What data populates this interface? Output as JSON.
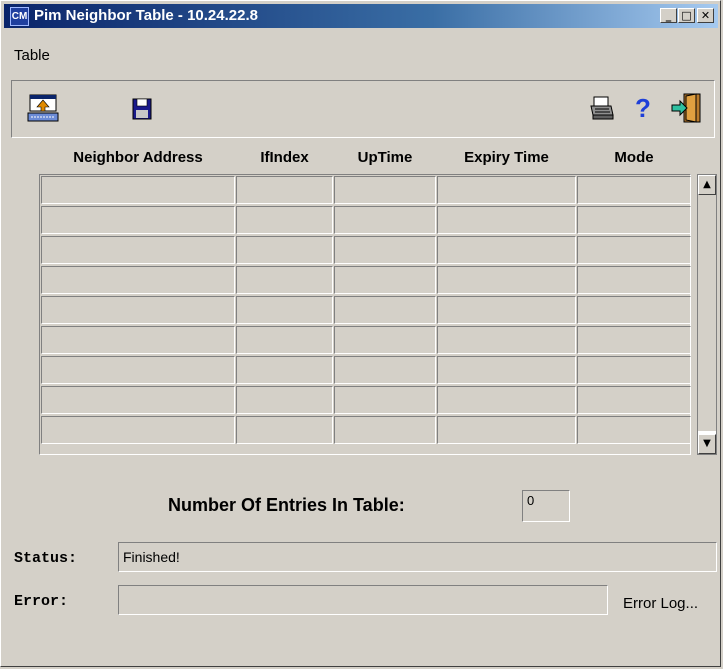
{
  "window": {
    "title": "Pim Neighbor Table - 10.24.22.8",
    "app_icon_text": "CM",
    "minimize_glyph": "_",
    "maximize_glyph": "□",
    "close_glyph": "✕"
  },
  "menu": {
    "items": [
      "Table"
    ]
  },
  "toolbar": {
    "left": [
      {
        "name": "load-table-icon"
      },
      {
        "name": "save-disk-icon"
      }
    ],
    "right": [
      {
        "name": "print-icon"
      },
      {
        "name": "help-icon",
        "glyph": "?"
      },
      {
        "name": "exit-door-icon"
      }
    ]
  },
  "table": {
    "columns": [
      "Neighbor Address",
      "IfIndex",
      "UpTime",
      "Expiry Time",
      "Mode"
    ],
    "rows": [
      [
        "",
        "",
        "",
        "",
        ""
      ],
      [
        "",
        "",
        "",
        "",
        ""
      ],
      [
        "",
        "",
        "",
        "",
        ""
      ],
      [
        "",
        "",
        "",
        "",
        ""
      ],
      [
        "",
        "",
        "",
        "",
        ""
      ],
      [
        "",
        "",
        "",
        "",
        ""
      ],
      [
        "",
        "",
        "",
        "",
        ""
      ],
      [
        "",
        "",
        "",
        "",
        ""
      ],
      [
        "",
        "",
        "",
        "",
        ""
      ]
    ],
    "scroll_up_glyph": "▲",
    "scroll_down_glyph": "▼"
  },
  "entries": {
    "label": "Number Of Entries In Table:",
    "value": "0"
  },
  "status": {
    "label": "Status:",
    "value": "Finished!"
  },
  "error": {
    "label": "Error:",
    "value": "",
    "log_link": "Error Log..."
  },
  "colors": {
    "window_bg": "#d4d0c8",
    "title_gradient_start": "#0a246a",
    "title_gradient_end": "#a6caf0",
    "help_icon": "#1e3fd8",
    "exit_icon": "#2e8b57"
  }
}
